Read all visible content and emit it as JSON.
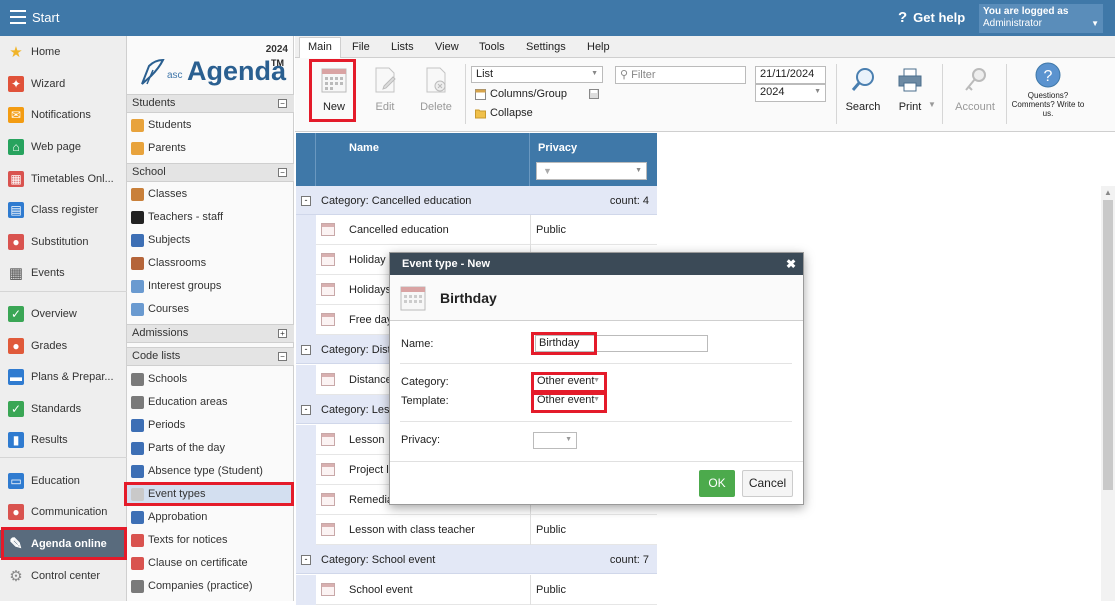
{
  "topbar": {
    "start": "Start",
    "help": "Get help",
    "logged_as": "You are logged as",
    "user": "Administrator"
  },
  "leftnav": [
    {
      "label": "Home",
      "icon": "star-icon",
      "color": "#f0b429"
    },
    {
      "label": "Wizard",
      "icon": "wizard-icon",
      "color": "#e0523a"
    },
    {
      "label": "Notifications",
      "icon": "envelope-icon",
      "color": "#f39c12"
    },
    {
      "label": "Web page",
      "icon": "house-icon",
      "color": "#27a35e"
    },
    {
      "label": "Timetables Onl...",
      "icon": "timetable-icon",
      "color": "#d9534f"
    },
    {
      "label": "Class register",
      "icon": "register-icon",
      "color": "#2f7bd0"
    },
    {
      "label": "Substitution",
      "icon": "substitution-icon",
      "color": "#d9534f"
    },
    {
      "label": "Events",
      "icon": "calendar-icon",
      "color": "#555555"
    },
    {
      "label": "Overview",
      "icon": "check-icon",
      "color": "#3aa655"
    },
    {
      "label": "Grades",
      "icon": "grades-icon",
      "color": "#e05a3a"
    },
    {
      "label": "Plans & Prepar...",
      "icon": "plans-icon",
      "color": "#2f7bd0"
    },
    {
      "label": "Standards",
      "icon": "shield-check-icon",
      "color": "#3aa655"
    },
    {
      "label": "Results",
      "icon": "bar-chart-icon",
      "color": "#2f7bd0"
    },
    {
      "label": "Education",
      "icon": "education-icon",
      "color": "#2f7bd0"
    },
    {
      "label": "Communication",
      "icon": "chat-icon",
      "color": "#d9534f"
    },
    {
      "label": "Agenda online",
      "icon": "feather-icon",
      "color": "#ffffff"
    },
    {
      "label": "Control center",
      "icon": "gear-icon",
      "color": "#888888"
    }
  ],
  "logo": {
    "year": "2024",
    "asc": "asc",
    "name": "Agenda",
    "tm": "TM"
  },
  "panel2": {
    "students_head": "Students",
    "students": [
      "Students",
      "Parents"
    ],
    "school_head": "School",
    "school": [
      "Classes",
      "Teachers - staff",
      "Subjects",
      "Classrooms",
      "Interest groups",
      "Courses"
    ],
    "admissions_head": "Admissions",
    "codelists_head": "Code lists",
    "codelists": [
      "Schools",
      "Education areas",
      "Periods",
      "Parts of the day",
      "Absence type (Student)",
      "Event types",
      "Approbation",
      "Texts for notices",
      "Clause on certificate",
      "Companies (practice)"
    ]
  },
  "ribbon": {
    "tabs": [
      "Main",
      "File",
      "Lists",
      "View",
      "Tools",
      "Settings",
      "Help"
    ],
    "new": "New",
    "edit": "Edit",
    "delete": "Delete",
    "view_select": "List",
    "columns": "Columns/Group",
    "collapse": "Collapse",
    "filter_placeholder": "Filter",
    "date": "21/11/2024",
    "year": "2024",
    "search": "Search",
    "print": "Print",
    "account": "Account",
    "questions": "Questions? Comments? Write to us."
  },
  "grid": {
    "col_name": "Name",
    "col_privacy": "Privacy",
    "categories": [
      {
        "label": "Category: Cancelled education",
        "count": "count: 4"
      },
      {
        "label": "Category: Dist",
        "count": ""
      },
      {
        "label": "Category: Less",
        "count": ""
      },
      {
        "label": "Category: School event",
        "count": "count: 7"
      }
    ],
    "rows": [
      {
        "name": "Cancelled education",
        "privacy": "Public"
      },
      {
        "name": "Holiday",
        "privacy": ""
      },
      {
        "name": "Holidays",
        "privacy": ""
      },
      {
        "name": "Free day",
        "privacy": ""
      },
      {
        "name": "Distance",
        "privacy": ""
      },
      {
        "name": "Lesson",
        "privacy": ""
      },
      {
        "name": "Project le",
        "privacy": ""
      },
      {
        "name": "Remedia",
        "privacy": ""
      },
      {
        "name": "Lesson with class teacher",
        "privacy": "Public"
      },
      {
        "name": "School event",
        "privacy": "Public"
      }
    ]
  },
  "dialog": {
    "title": "Event type - New",
    "header": "Birthday",
    "name_label": "Name:",
    "name_value": "Birthday",
    "category_label": "Category:",
    "category_value": "Other event",
    "template_label": "Template:",
    "template_value": "Other event",
    "privacy_label": "Privacy:",
    "ok": "OK",
    "cancel": "Cancel"
  }
}
